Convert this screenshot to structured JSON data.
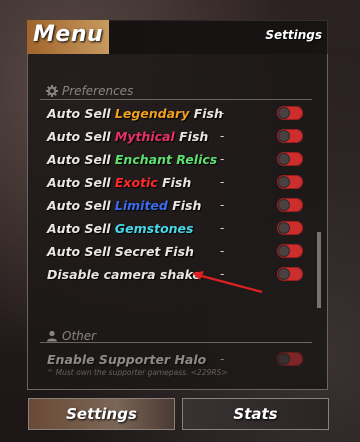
{
  "header": {
    "title": "Menu",
    "link_label": "Settings"
  },
  "sections": {
    "preferences": {
      "label": "Preferences",
      "icon": "gear-icon"
    },
    "other": {
      "label": "Other",
      "icon": "person-icon"
    }
  },
  "rows": [
    {
      "prefix": "Auto Sell ",
      "highlight": "Legendary",
      "highlight_color": "#f0a020",
      "suffix": " Fish",
      "value": "-",
      "toggle": "off"
    },
    {
      "prefix": "Auto Sell ",
      "highlight": "Mythical",
      "highlight_color": "#e8306a",
      "suffix": " Fish",
      "value": "-",
      "toggle": "off"
    },
    {
      "prefix": "Auto Sell ",
      "highlight": "Enchant Relics",
      "highlight_color": "#5ee070",
      "suffix": "",
      "value": "-",
      "toggle": "off"
    },
    {
      "prefix": "Auto Sell ",
      "highlight": "Exotic",
      "highlight_color": "#ff2a2a",
      "suffix": " Fish",
      "value": "-",
      "toggle": "off"
    },
    {
      "prefix": "Auto Sell ",
      "highlight": "Limited",
      "highlight_color": "#3a6cf0",
      "suffix": " Fish",
      "value": "-",
      "toggle": "off"
    },
    {
      "prefix": "Auto Sell ",
      "highlight": "Gemstones",
      "highlight_color": "#48d8e8",
      "suffix": "",
      "value": "-",
      "toggle": "off"
    },
    {
      "prefix": "Auto Sell Secret Fish",
      "highlight": "",
      "highlight_color": "#ffffff",
      "suffix": "",
      "value": "-",
      "toggle": "off"
    },
    {
      "prefix": "Disable camera shake",
      "highlight": "",
      "highlight_color": "#ffffff",
      "suffix": "",
      "value": "-",
      "toggle": "off"
    }
  ],
  "other_row": {
    "label": "Enable Supporter Halo",
    "value": "-",
    "note": "^ Must own the supporter gamepass. <229RS>",
    "toggle": "off"
  },
  "tabs": {
    "settings": "Settings",
    "stats": "Stats"
  },
  "colors": {
    "toggle_off": "#cc2e2e",
    "header_accent": "#b07a40",
    "annotation_arrow": "#e02020"
  }
}
